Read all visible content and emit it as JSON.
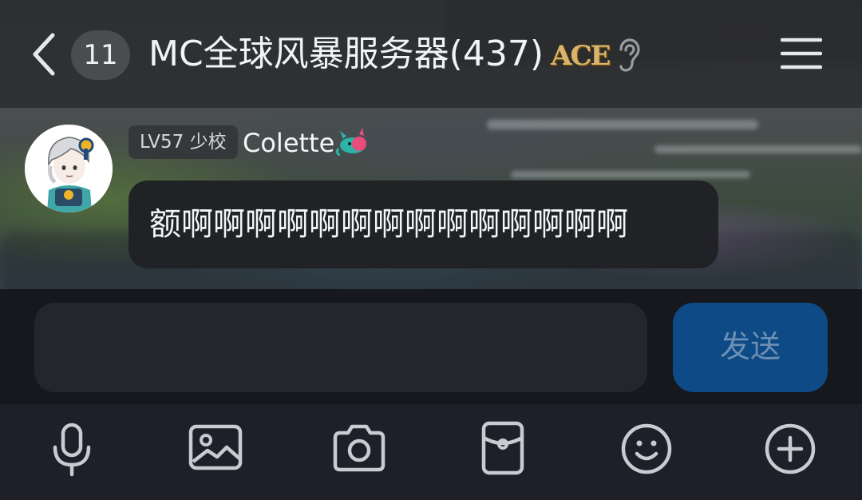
{
  "header": {
    "unread_count": "11",
    "title": "MC全球风暴服务器(437)",
    "badge_text": "ACE"
  },
  "message": {
    "level_badge": "LV57 少校",
    "username": "Colette",
    "text": "额啊啊啊啊啊啊啊啊啊啊啊啊啊啊"
  },
  "composer": {
    "input_value": "",
    "send_label": "发送"
  },
  "toolbar": {
    "icons": [
      "microphone-icon",
      "image-icon",
      "camera-icon",
      "red-packet-icon",
      "emoji-icon",
      "plus-icon"
    ]
  },
  "colors": {
    "send_button": "#0d4a86",
    "bubble": "#202226",
    "toolbar_bg": "#1e1f29"
  }
}
